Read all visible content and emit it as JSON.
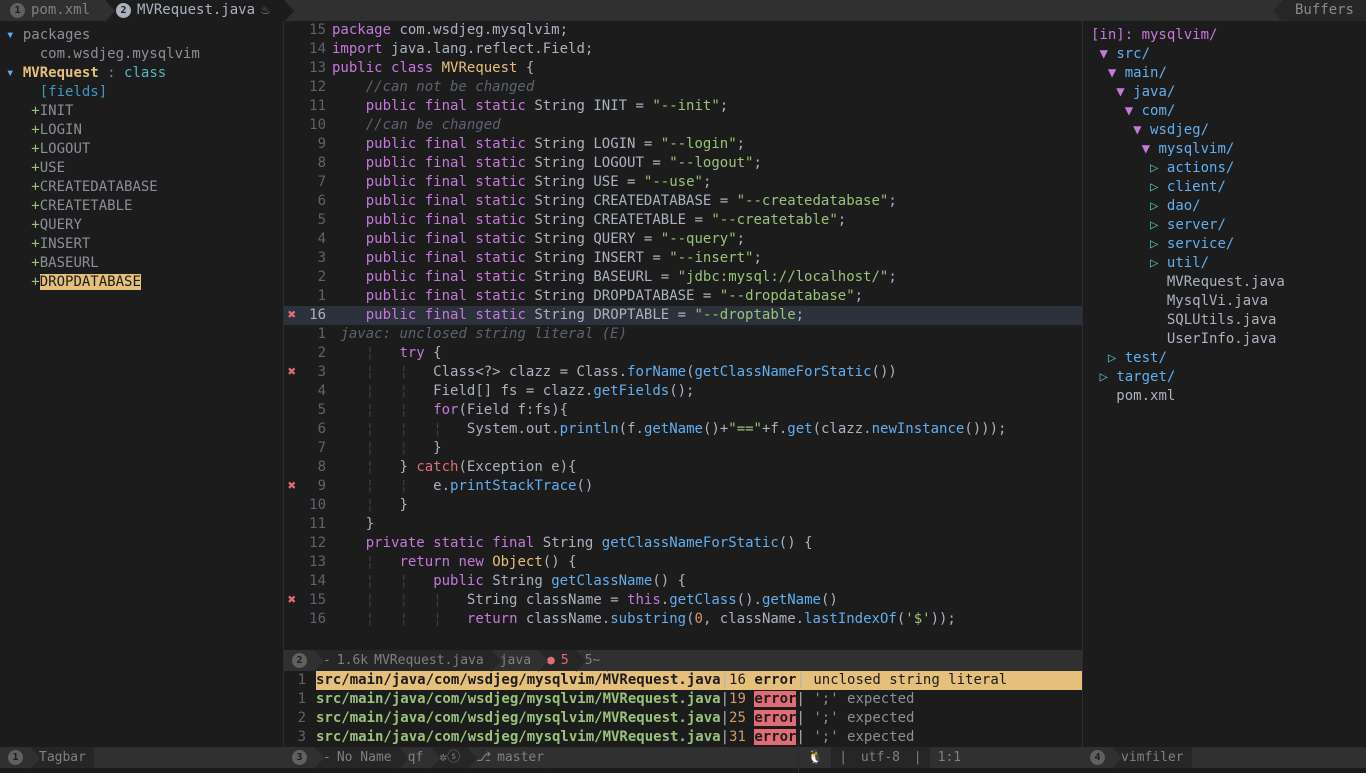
{
  "topbar": {
    "tab1_num": "1",
    "tab1_label": "pom.xml",
    "tab2_num": "2",
    "tab2_label": "MVRequest.java",
    "buffers": "Buffers"
  },
  "outline": {
    "pkg_fold": "▾",
    "pkg_label": "packages",
    "pkg_name": "com.wsdjeg.mysqlvim",
    "class_fold": "▾",
    "class_name": "MVRequest",
    "class_sep": " : ",
    "class_type": "class",
    "fields_label": "[fields]",
    "members": [
      "INIT",
      "LOGIN",
      "LOGOUT",
      "USE",
      "CREATEDATABASE",
      "CREATETABLE",
      "QUERY",
      "INSERT",
      "BASEURL",
      "DROPDATABASE"
    ],
    "member_highlight": "DROPDATABASE"
  },
  "code_lines": [
    {
      "sign": "",
      "num": "15",
      "cls": "",
      "html": "<span class='k-pkg'>package</span> com.wsdjeg.mysqlvim;"
    },
    {
      "sign": "",
      "num": "14",
      "cls": "",
      "html": "<span class='k-imp'>import</span> java.lang.reflect.Field;"
    },
    {
      "sign": "",
      "num": "13",
      "cls": "",
      "html": "<span class='k-mod'>public</span> <span class='k-mod'>class</span> <span class='k-type'>MVRequest</span> {"
    },
    {
      "sign": "",
      "num": "12",
      "cls": "",
      "html": "    <span class='k-com'>//can not be changed</span>"
    },
    {
      "sign": "",
      "num": "11",
      "cls": "",
      "html": "    <span class='k-mod'>public</span> <span class='k-mod'>final</span> <span class='k-mod'>static</span> String INIT = <span class='k-str'>\"--init\"</span>;"
    },
    {
      "sign": "",
      "num": "10",
      "cls": "",
      "html": "    <span class='k-com'>//can be changed</span>"
    },
    {
      "sign": "",
      "num": "9",
      "cls": "",
      "html": "    <span class='k-mod'>public</span> <span class='k-mod'>final</span> <span class='k-mod'>static</span> String LOGIN = <span class='k-str'>\"--login\"</span>;"
    },
    {
      "sign": "",
      "num": "8",
      "cls": "",
      "html": "    <span class='k-mod'>public</span> <span class='k-mod'>final</span> <span class='k-mod'>static</span> String LOGOUT = <span class='k-str'>\"--logout\"</span>;"
    },
    {
      "sign": "",
      "num": "7",
      "cls": "",
      "html": "    <span class='k-mod'>public</span> <span class='k-mod'>final</span> <span class='k-mod'>static</span> String USE = <span class='k-str'>\"--use\"</span>;"
    },
    {
      "sign": "",
      "num": "6",
      "cls": "",
      "html": "    <span class='k-mod'>public</span> <span class='k-mod'>final</span> <span class='k-mod'>static</span> String CREATEDATABASE = <span class='k-str'>\"--createdatabase\"</span>;"
    },
    {
      "sign": "",
      "num": "5",
      "cls": "",
      "html": "    <span class='k-mod'>public</span> <span class='k-mod'>final</span> <span class='k-mod'>static</span> String CREATETABLE = <span class='k-str'>\"--createtable\"</span>;"
    },
    {
      "sign": "",
      "num": "4",
      "cls": "",
      "html": "    <span class='k-mod'>public</span> <span class='k-mod'>final</span> <span class='k-mod'>static</span> String QUERY = <span class='k-str'>\"--query\"</span>;"
    },
    {
      "sign": "",
      "num": "3",
      "cls": "",
      "html": "    <span class='k-mod'>public</span> <span class='k-mod'>final</span> <span class='k-mod'>static</span> String INSERT = <span class='k-str'>\"--insert\"</span>;"
    },
    {
      "sign": "",
      "num": "2",
      "cls": "",
      "html": "    <span class='k-mod'>public</span> <span class='k-mod'>final</span> <span class='k-mod'>static</span> String BASEURL = <span class='k-str'>\"jdbc:mysql://localhost/\"</span>;"
    },
    {
      "sign": "",
      "num": "1",
      "cls": "",
      "html": "    <span class='k-mod'>public</span> <span class='k-mod'>final</span> <span class='k-mod'>static</span> String DROPDATABASE = <span class='k-str'>\"--dropdatabase\"</span>;"
    },
    {
      "sign": "✖",
      "num": "16",
      "cls": "cl",
      "cur": true,
      "html": "    <span class='k-mod'>public</span> <span class='k-mod'>final</span> <span class='k-mod'>static</span> String DROPTABLE = <span class='k-str'>\"--droptable</span>;"
    },
    {
      "sign": "",
      "num": "1",
      "cls": "",
      "html": " <span class='k-com'>javac: unclosed string literal (E)</span>"
    },
    {
      "sign": "",
      "num": "2",
      "cls": "",
      "html": "    <span class='k-guide'>¦</span>   <span class='k-kw'>try</span> {"
    },
    {
      "sign": "✖",
      "num": "3",
      "cls": "",
      "html": "    <span class='k-guide'>¦</span>   <span class='k-guide'>¦</span>   Class&lt;?&gt; clazz = Class.<span class='k-fn'>forName</span>(<span class='k-fn'>getClassNameForStatic</span>())"
    },
    {
      "sign": "",
      "num": "4",
      "cls": "",
      "html": "    <span class='k-guide'>¦</span>   <span class='k-guide'>¦</span>   Field[] fs = clazz.<span class='k-fn'>getFields</span>();"
    },
    {
      "sign": "",
      "num": "5",
      "cls": "",
      "html": "    <span class='k-guide'>¦</span>   <span class='k-guide'>¦</span>   <span class='k-kw'>for</span>(Field f:fs){"
    },
    {
      "sign": "",
      "num": "6",
      "cls": "",
      "html": "    <span class='k-guide'>¦</span>   <span class='k-guide'>¦</span>   <span class='k-guide'>¦</span>   System.out.<span class='k-fn'>println</span>(f.<span class='k-fn'>getName</span>()+<span class='k-str'>\"==\"</span>+f.<span class='k-fn'>get</span>(clazz.<span class='k-fn'>newInstance</span>()));"
    },
    {
      "sign": "",
      "num": "7",
      "cls": "",
      "html": "    <span class='k-guide'>¦</span>   <span class='k-guide'>¦</span>   }"
    },
    {
      "sign": "",
      "num": "8",
      "cls": "",
      "html": "    <span class='k-guide'>¦</span>   } <span class='k-err'>catch</span>(Exception e){"
    },
    {
      "sign": "✖",
      "num": "9",
      "cls": "",
      "html": "    <span class='k-guide'>¦</span>   <span class='k-guide'>¦</span>   e.<span class='k-fn'>printStackTrace</span>()"
    },
    {
      "sign": "",
      "num": "10",
      "cls": "",
      "html": "    <span class='k-guide'>¦</span>   }"
    },
    {
      "sign": "",
      "num": "11",
      "cls": "",
      "html": "    }"
    },
    {
      "sign": "",
      "num": "12",
      "cls": "",
      "html": "    <span class='k-mod'>private</span> <span class='k-mod'>static</span> <span class='k-mod'>final</span> String <span class='k-fn'>getClassNameForStatic</span>() {"
    },
    {
      "sign": "",
      "num": "13",
      "cls": "",
      "html": "    <span class='k-guide'>¦</span>   <span class='k-kw'>return</span> <span class='k-kw'>new</span> <span class='k-type'>Object</span>() {"
    },
    {
      "sign": "",
      "num": "14",
      "cls": "",
      "html": "    <span class='k-guide'>¦</span>   <span class='k-guide'>¦</span>   <span class='k-mod'>public</span> String <span class='k-fn'>getClassName</span>() {"
    },
    {
      "sign": "✖",
      "num": "15",
      "cls": "",
      "html": "    <span class='k-guide'>¦</span>   <span class='k-guide'>¦</span>   <span class='k-guide'>¦</span>   String className = <span class='k-this'>this</span>.<span class='k-fn'>getClass</span>().<span class='k-fn'>getName</span>()"
    },
    {
      "sign": "",
      "num": "16",
      "cls": "",
      "html": "    <span class='k-guide'>¦</span>   <span class='k-guide'>¦</span>   <span class='k-guide'>¦</span>   <span class='k-kw'>return</span> className.<span class='k-fn'>substring</span>(<span class='k-num'>0</span>, className.<span class='k-fn'>lastIndexOf</span>(<span class='k-str'>'$'</span>));"
    }
  ],
  "status_center": {
    "win_num": "2",
    "mod": "-",
    "size": "1.6k",
    "file": "MVRequest.java",
    "filetype": "java",
    "err_dot": "●",
    "err_count": "5",
    "warn": "5~"
  },
  "qf": [
    {
      "num": "1",
      "sel": true,
      "file": "src/main/java/com/wsdjeg/mysqlvim/MVRequest.java",
      "ln": "16",
      "err": "error",
      "msg": " unclosed string literal"
    },
    {
      "num": "1",
      "sel": false,
      "file": "src/main/java/com/wsdjeg/mysqlvim/MVRequest.java",
      "ln": "19",
      "err": "error",
      "msg": " ';' expected"
    },
    {
      "num": "2",
      "sel": false,
      "file": "src/main/java/com/wsdjeg/mysqlvim/MVRequest.java",
      "ln": "25",
      "err": "error",
      "msg": " ';' expected"
    },
    {
      "num": "3",
      "sel": false,
      "file": "src/main/java/com/wsdjeg/mysqlvim/MVRequest.java",
      "ln": "31",
      "err": "error",
      "msg": " ';' expected"
    }
  ],
  "filetree": {
    "root": "[in]: mysqlvim/",
    "lines": [
      {
        "indent": 0,
        "open": true,
        "name": "src/",
        "dir": true
      },
      {
        "indent": 1,
        "open": true,
        "name": "main/",
        "dir": true
      },
      {
        "indent": 2,
        "open": true,
        "name": "java/",
        "dir": true
      },
      {
        "indent": 3,
        "open": true,
        "name": "com/",
        "dir": true
      },
      {
        "indent": 4,
        "open": true,
        "name": "wsdjeg/",
        "dir": true
      },
      {
        "indent": 5,
        "open": true,
        "name": "mysqlvim/",
        "dir": true
      },
      {
        "indent": 6,
        "open": false,
        "name": "actions/",
        "dir": true
      },
      {
        "indent": 6,
        "open": false,
        "name": "client/",
        "dir": true
      },
      {
        "indent": 6,
        "open": false,
        "name": "dao/",
        "dir": true
      },
      {
        "indent": 6,
        "open": false,
        "name": "server/",
        "dir": true
      },
      {
        "indent": 6,
        "open": false,
        "name": "service/",
        "dir": true
      },
      {
        "indent": 6,
        "open": false,
        "name": "util/",
        "dir": true
      },
      {
        "indent": 6,
        "name": "MVRequest.java",
        "dir": false
      },
      {
        "indent": 6,
        "name": "MysqlVi.java",
        "dir": false
      },
      {
        "indent": 6,
        "name": "SQLUtils.java",
        "dir": false
      },
      {
        "indent": 6,
        "name": "UserInfo.java",
        "dir": false
      },
      {
        "indent": 1,
        "open": false,
        "name": "test/",
        "dir": true
      },
      {
        "indent": 0,
        "open": false,
        "name": "target/",
        "dir": true
      },
      {
        "indent": 0,
        "name": "pom.xml",
        "dir": false
      }
    ]
  },
  "bottom": {
    "left_num": "1",
    "left_label": "Tagbar",
    "mid_num": "3",
    "mid_mod": "-",
    "mid_name": "No Name",
    "mid_qf": "qf",
    "mid_cog": "✲ⓢ",
    "mid_branch_icon": "⎇",
    "mid_branch": "master",
    "enc": "utf-8",
    "pos": "1:1",
    "tux": "🐧",
    "right_num": "4",
    "right_label": "vimfiler"
  }
}
